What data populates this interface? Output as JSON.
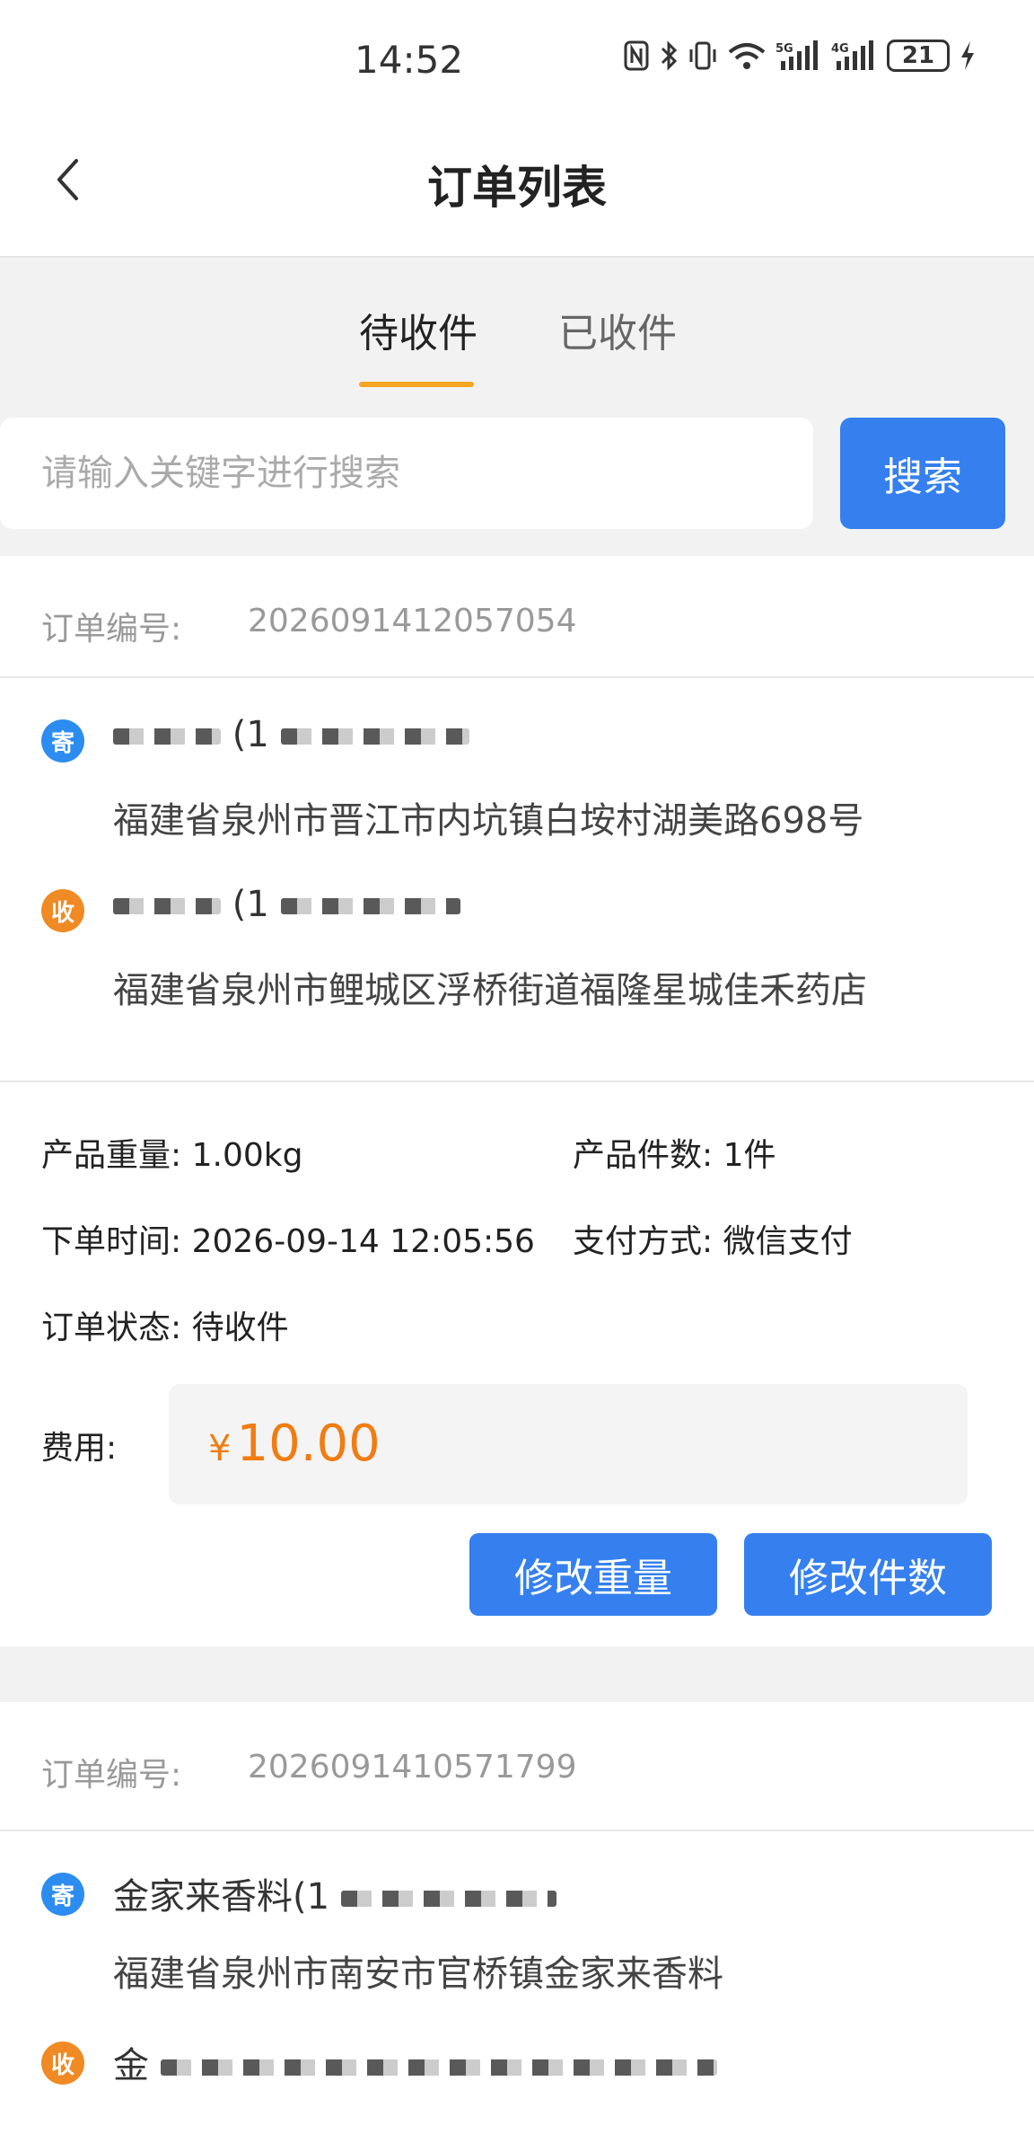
{
  "status_bar": {
    "time": "14:52",
    "battery": "21",
    "icons": [
      "nfc-icon",
      "bluetooth-icon",
      "vibrate-icon",
      "wifi-icon",
      "signal-5g-icon",
      "signal-4g-icon",
      "battery-icon",
      "charging-icon"
    ]
  },
  "nav": {
    "title": "订单列表",
    "back_icon": "chevron-left-icon"
  },
  "tabs": [
    {
      "label": "待收件",
      "active": true
    },
    {
      "label": "已收件",
      "active": false
    }
  ],
  "search": {
    "placeholder": "请输入关键字进行搜索",
    "button_label": "搜索"
  },
  "orders": [
    {
      "order_no_label": "订单编号:",
      "order_no": "2026091412057054",
      "sender": {
        "badge": "寄",
        "name_phone": "(1",
        "address": "福建省泉州市晋江市内坑镇白垵村湖美路698号"
      },
      "receiver": {
        "badge": "收",
        "name_phone": "(1",
        "address": "福建省泉州市鲤城区浮桥街道福隆星城佳禾药店"
      },
      "weight_label": "产品重量:",
      "weight": "1.00kg",
      "count_label": "产品件数:",
      "count": "1件",
      "time_label": "下单时间:",
      "time": "2026-09-14 12:05:56",
      "pay_label": "支付方式:",
      "pay": "微信支付",
      "status_label": "订单状态:",
      "status": "待收件",
      "fee_label": "费用:",
      "fee_currency": "¥",
      "fee": "10.00",
      "btn_edit_weight": "修改重量",
      "btn_edit_count": "修改件数"
    },
    {
      "order_no_label": "订单编号:",
      "order_no": "2026091410571799",
      "sender": {
        "badge": "寄",
        "name_phone": "金家来香料(1",
        "address": "福建省泉州市南安市官桥镇金家来香料"
      },
      "receiver": {
        "badge": "收",
        "name_phone": "金",
        "address": ""
      }
    }
  ],
  "colors": {
    "primary": "#3580ee",
    "accent": "#f5a623",
    "fee": "#f07c12",
    "send_badge": "#2d8cf0",
    "recv_badge": "#f08a24"
  }
}
